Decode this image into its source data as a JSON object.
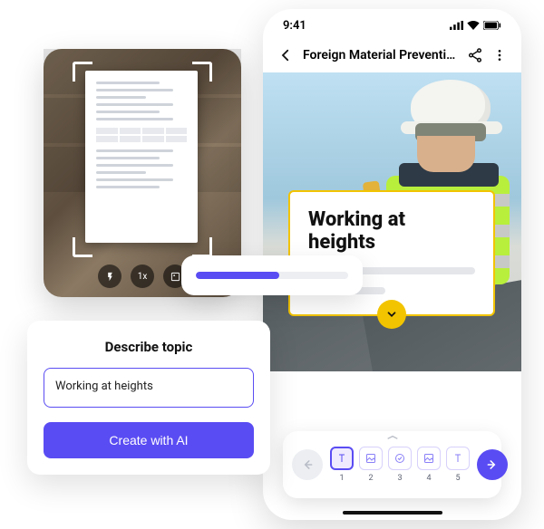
{
  "phone": {
    "status": {
      "time": "9:41"
    },
    "header": {
      "title": "Foreign Material Prevention..."
    },
    "lesson": {
      "title": "Working at heights"
    },
    "steps": [
      {
        "num": "1"
      },
      {
        "num": "2"
      },
      {
        "num": "3"
      },
      {
        "num": "4"
      },
      {
        "num": "5"
      }
    ]
  },
  "scanner": {
    "zoom": "1x"
  },
  "progress": {
    "percent": 55
  },
  "topic": {
    "label": "Describe topic",
    "value": "Working at heights",
    "cta": "Create with AI"
  },
  "colors": {
    "primary": "#5a4cf3",
    "accent": "#f2c400"
  }
}
